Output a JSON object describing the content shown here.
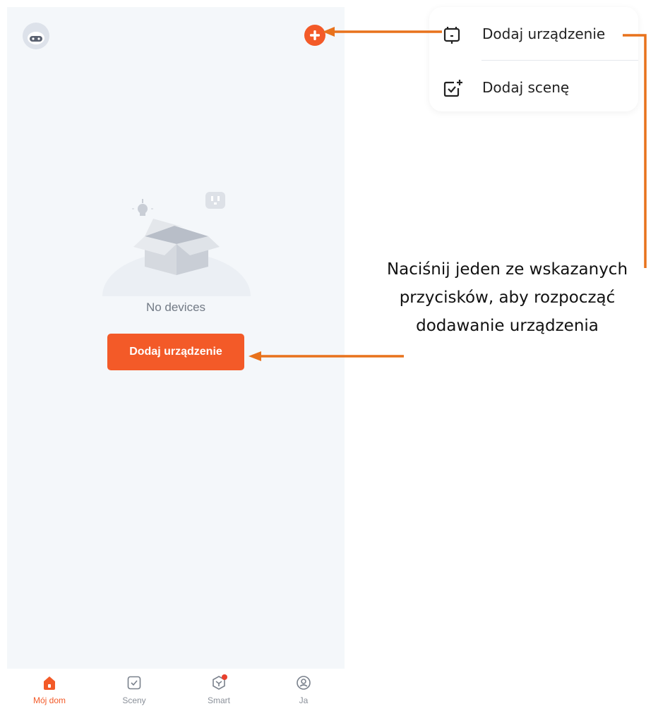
{
  "app": {
    "empty_state_text": "No devices",
    "primary_button_label": "Dodaj urządzenie"
  },
  "menu": {
    "items": [
      {
        "label": "Dodaj urządzenie",
        "icon": "device-icon"
      },
      {
        "label": "Dodaj scenę",
        "icon": "scene-add-icon"
      }
    ]
  },
  "tabbar": {
    "tabs": [
      {
        "label": "Mój dom",
        "icon": "home-icon",
        "active": true
      },
      {
        "label": "Sceny",
        "icon": "scenes-checkbox-icon",
        "active": false
      },
      {
        "label": "Smart",
        "icon": "smart-icon",
        "active": false,
        "badge": true
      },
      {
        "label": "Ja",
        "icon": "profile-icon",
        "active": false
      }
    ]
  },
  "annotation": {
    "lines": [
      "Naciśnij jeden ze wskazanych",
      "przycisków, aby rozpocząć",
      "dodawanie urządzenia"
    ]
  },
  "colors": {
    "accent": "#f35a28",
    "annotation_arrow": "#e8721c",
    "screen_background": "#f4f7fa"
  }
}
